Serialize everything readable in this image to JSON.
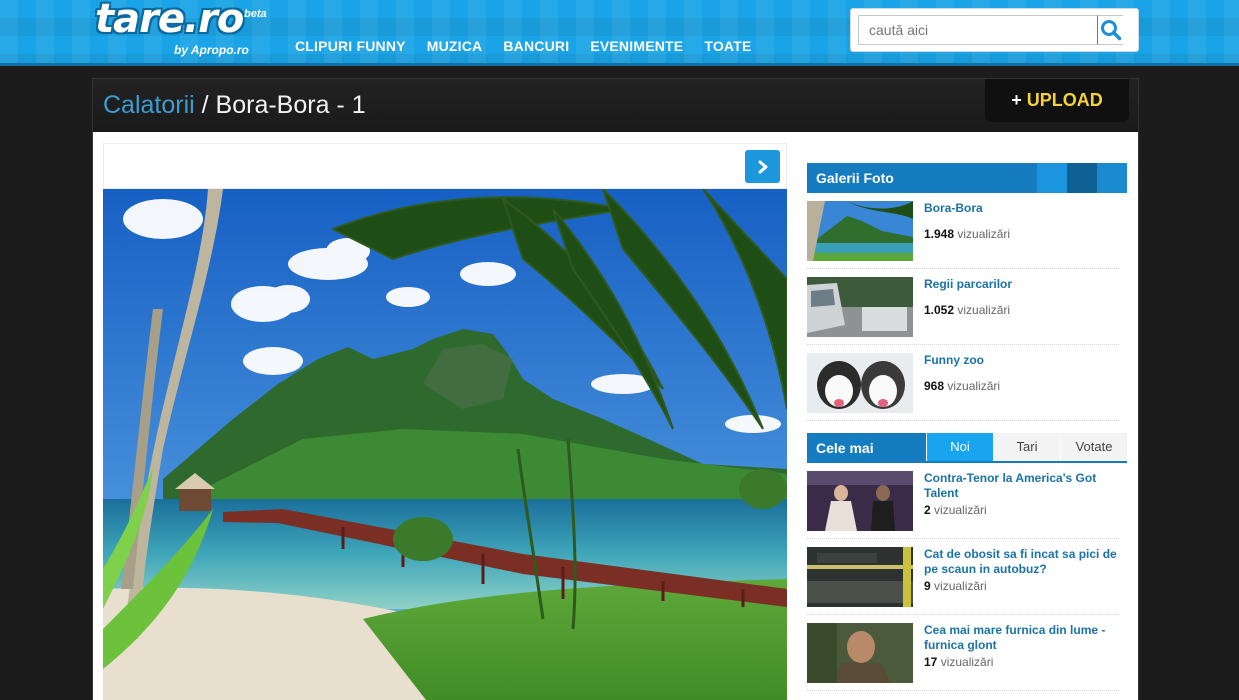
{
  "header": {
    "logo": "tare.ro",
    "logo_beta": "beta",
    "logo_by": "by Apropo.ro",
    "nav": [
      "CLIPURI FUNNY",
      "MUZICA",
      "BANCURI",
      "EVENIMENTE",
      "TOATE"
    ],
    "search_placeholder": "caută aici"
  },
  "page": {
    "breadcrumb_category": "Calatorii",
    "breadcrumb_sep": " / ",
    "title": "Bora-Bora - 1",
    "upload_plus": "+",
    "upload_label": "UPLOAD"
  },
  "sidebar": {
    "gallery_title": "Galerii Foto",
    "views_word": "vizualizări",
    "galleries": [
      {
        "title": "Bora-Bora",
        "views": "1.948"
      },
      {
        "title": "Regii parcarilor",
        "views": "1.052"
      },
      {
        "title": "Funny zoo",
        "views": "968"
      }
    ],
    "tabs_label": "Cele mai",
    "tabs": [
      "Noi",
      "Tari",
      "Votate"
    ],
    "active_tab": "Noi",
    "videos": [
      {
        "title": "Contra-Tenor la America's Got Talent",
        "views": "2"
      },
      {
        "title": "Cat de obosit sa fi incat sa pici de pe scaun in autobuz?",
        "views": "9"
      },
      {
        "title": "Cea mai mare furnica din lume - furnica glont",
        "views": "17"
      }
    ]
  },
  "colors": {
    "header_blue": "#1aa3e6",
    "accent_blue": "#157cbf",
    "active_tab": "#18a4ef",
    "upload_yellow": "#f6d13a",
    "link_blue": "#1a73a8"
  }
}
